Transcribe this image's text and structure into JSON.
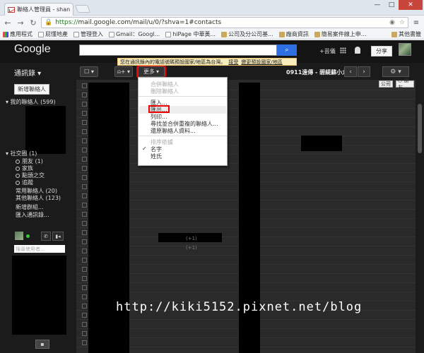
{
  "browser": {
    "tab_title": "聯絡人管理員 - shan",
    "url_scheme": "https://",
    "url_rest": "mail.google.com/mail/u/0/?shva=1#contacts",
    "bookmarks": [
      "應用程式",
      "屁懂地產",
      "管理登入",
      "Gmail：Googl...",
      "hiPage 中華黃...",
      "公司及分公司基...",
      "廠商資訊",
      "簡易案件線上申..."
    ],
    "other_bookmarks": "其他書籤",
    "min": "—",
    "max": "□",
    "close": "✕"
  },
  "gmail": {
    "logo": "Google",
    "user_short": "+芸儀",
    "share_label": "分享",
    "banner_text": "您在通訊錄內的電話號碼預設國家/地區為台灣。",
    "banner_link": "接受",
    "banner_link2": "變更預設國家/地區",
    "contacts_title": "通訊錄 ▾",
    "more_label": "更多",
    "pager_text": "0911遠傳 - 碧緹蘇小九",
    "prev": "‹",
    "next": "›",
    "settings": "⚙ ▾",
    "new_contact": "新增聯絡人",
    "my_contacts": "▾ 我的聯絡人 (599)",
    "circles": "▾ 社交圈 (1)",
    "circle_items": [
      "朋友 (1)",
      "家族",
      "點頭之交",
      "追蹤"
    ],
    "frequent": "常用聯絡人 (20)",
    "other_contacts": "其他聯絡人 (123)",
    "new_group": "新增群組...",
    "import": "匯入通訊錄...",
    "chat_search_placeholder": "搜尋使用者...",
    "company_chip": "公司",
    "friends_chip": "○ 朋友",
    "plus_one": "(+1)",
    "watermark": "http://kiki5152.pixnet.net/blog"
  },
  "more_menu": {
    "merge": "合併聯絡人",
    "delete": "刪除聯絡人",
    "import": "匯入...",
    "export": "匯出...",
    "print": "列印...",
    "find_dupes": "尋找並合併重複的聯絡人...",
    "restore": "還原聯絡人資料...",
    "sort_header": "排序依據",
    "sort_first": "名字",
    "sort_last": "姓氏"
  }
}
